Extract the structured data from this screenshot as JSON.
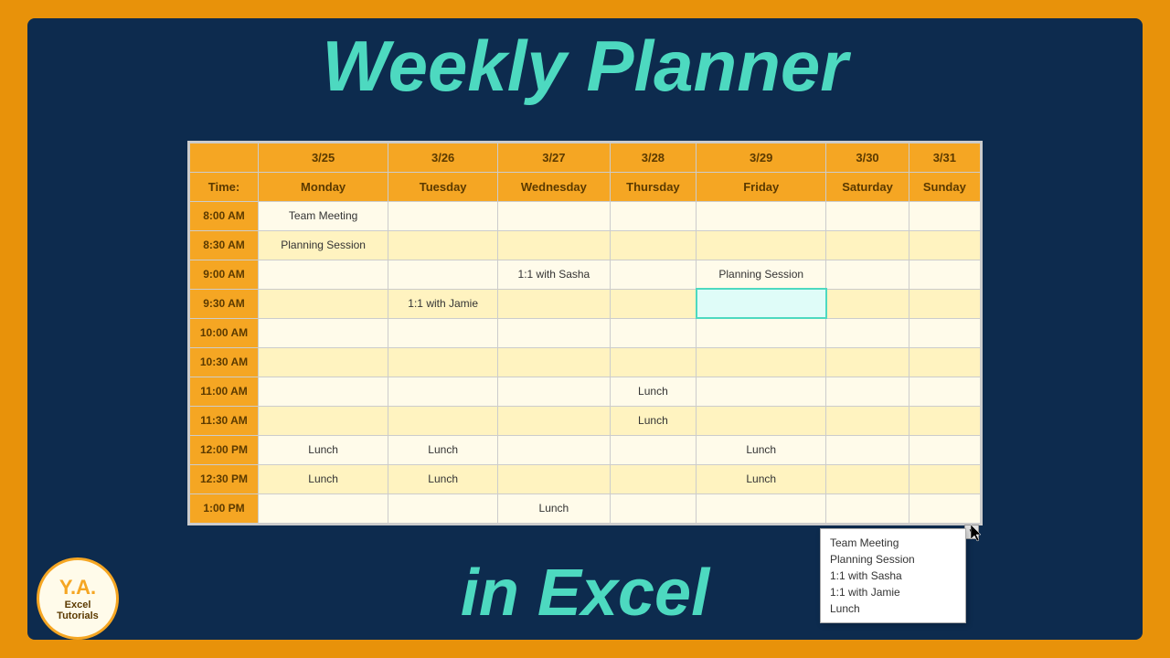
{
  "title": {
    "top": "Weekly Planner",
    "bottom": "in Excel"
  },
  "logo": {
    "ya": "Y.A.",
    "line1": "Excel",
    "line2": "Tutorials"
  },
  "calendar": {
    "dates": [
      "",
      "3/25",
      "3/26",
      "3/27",
      "3/28",
      "3/29",
      "3/30",
      "3/31"
    ],
    "days": [
      "Time:",
      "Monday",
      "Tuesday",
      "Wednesday",
      "Thursday",
      "Friday",
      "Saturday",
      "Sunday"
    ],
    "rows": [
      {
        "time": "8:00 AM",
        "cells": [
          "Team Meeting",
          "",
          "",
          "",
          "",
          "",
          ""
        ]
      },
      {
        "time": "8:30 AM",
        "cells": [
          "Planning Session",
          "",
          "",
          "",
          "",
          "",
          ""
        ]
      },
      {
        "time": "9:00 AM",
        "cells": [
          "",
          "",
          "1:1 with Sasha",
          "",
          "Planning Session",
          "",
          ""
        ]
      },
      {
        "time": "9:30 AM",
        "cells": [
          "",
          "1:1 with Jamie",
          "",
          "",
          "",
          "",
          ""
        ]
      },
      {
        "time": "10:00 AM",
        "cells": [
          "",
          "",
          "",
          "",
          "",
          "",
          ""
        ]
      },
      {
        "time": "10:30 AM",
        "cells": [
          "",
          "",
          "",
          "",
          "",
          "",
          ""
        ]
      },
      {
        "time": "11:00 AM",
        "cells": [
          "",
          "",
          "",
          "Lunch",
          "",
          "",
          ""
        ]
      },
      {
        "time": "11:30 AM",
        "cells": [
          "",
          "",
          "",
          "Lunch",
          "",
          "",
          ""
        ]
      },
      {
        "time": "12:00 PM",
        "cells": [
          "Lunch",
          "Lunch",
          "",
          "",
          "Lunch",
          "",
          ""
        ]
      },
      {
        "time": "12:30 PM",
        "cells": [
          "Lunch",
          "Lunch",
          "",
          "",
          "Lunch",
          "",
          ""
        ]
      },
      {
        "time": "1:00 PM",
        "cells": [
          "",
          "",
          "Lunch",
          "",
          "",
          "",
          ""
        ]
      }
    ]
  },
  "dropdown": {
    "items": [
      "Team Meeting",
      "Planning Session",
      "1:1 with Sasha",
      "1:1 with Jamie",
      "Lunch"
    ]
  }
}
